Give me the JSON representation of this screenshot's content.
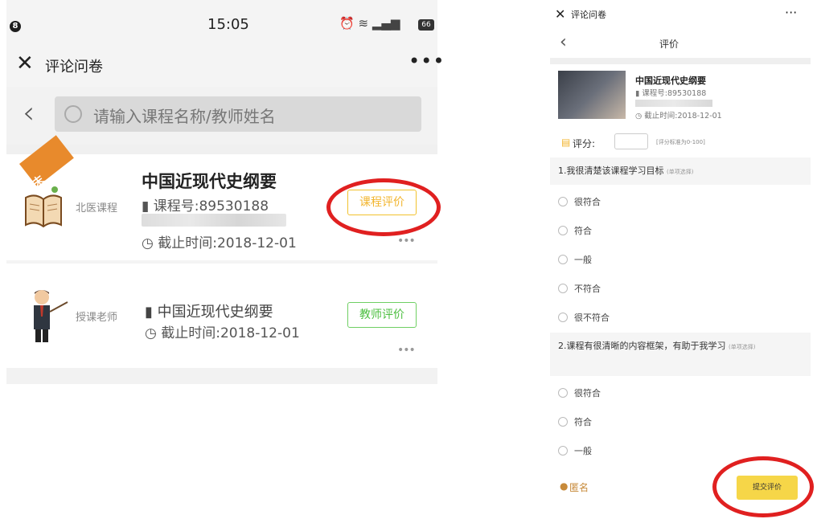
{
  "left": {
    "status": {
      "notif": "8",
      "time": "15:05",
      "battery": "66"
    },
    "header": {
      "title": "评论问卷",
      "more": "•••"
    },
    "search": {
      "placeholder": "请输入课程名称/教师姓名"
    },
    "cards": [
      {
        "ribbon": "期末",
        "tag": "北医课程",
        "title": "中国近现代史纲要",
        "course_no": "▮ 课程号:89530188",
        "deadline": "◷ 截止时间:2018-12-01",
        "button": "课程评价",
        "menu": "•••"
      },
      {
        "tag": "授课老师",
        "course_name": "▮ 中国近现代史纲要",
        "deadline": "◷ 截止时间:2018-12-01",
        "button": "教师评价",
        "menu": "•••"
      }
    ]
  },
  "right": {
    "header": {
      "title": "评论问卷",
      "more": "···"
    },
    "nav": {
      "title": "评价"
    },
    "course": {
      "title": "中国近现代史纲要",
      "course_no": "▮ 课程号:89530188",
      "deadline": "◷ 截止时间:2018-12-01"
    },
    "score": {
      "label": "评分:",
      "note": "[评分标准为0-100]"
    },
    "questions": [
      {
        "text": "1.我很清楚该课程学习目标",
        "type": "(单项选择)",
        "options": [
          "很符合",
          "符合",
          "一般",
          "不符合",
          "很不符合"
        ]
      },
      {
        "text": "2.课程有很清晰的内容框架，有助于我学习",
        "type": "(单项选择)",
        "options": [
          "很符合",
          "符合",
          "一般"
        ]
      }
    ],
    "footer": {
      "anonymous": "匿名",
      "submit": "提交评价"
    }
  },
  "colors": {
    "course_button": "#f2b52e",
    "teacher_button": "#4cbf40",
    "ribbon": "#e88a2c",
    "submit": "#f6d648",
    "annotation": "#e02020"
  }
}
